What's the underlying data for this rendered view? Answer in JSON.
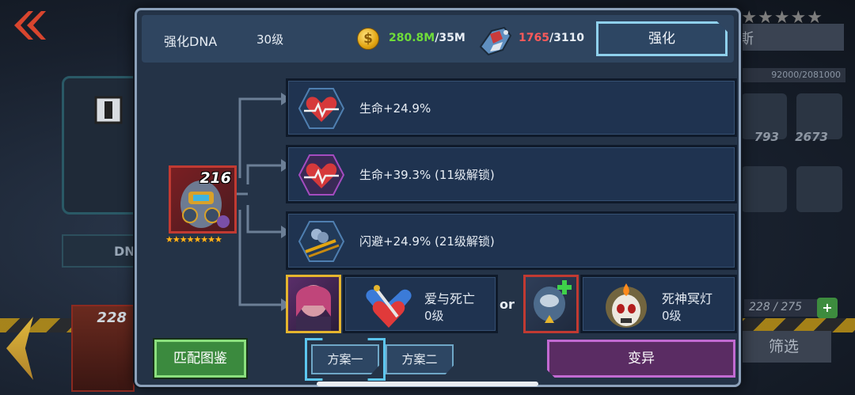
{
  "background": {
    "back_icon": "double-chevron-left-icon",
    "dna_tab": "DN",
    "card_level": "228",
    "stars": "★★★★★",
    "hero_name": "托斯",
    "exp": "92000/2081000",
    "item_counts": [
      "793",
      "2673"
    ],
    "slot_count": "228 / 275",
    "filter_label": "筛选"
  },
  "header": {
    "title": "强化DNA",
    "level": "30级",
    "coin_current": "280.8M",
    "coin_max": "/35M",
    "material_current": "1765",
    "material_max": "/3110",
    "enhance_label": "强化"
  },
  "hero": {
    "level": "216",
    "stars": "★★★★★★★★"
  },
  "bonuses": [
    {
      "icon": "heart-pulse-icon",
      "text": "生命+24.9%"
    },
    {
      "icon": "heart-pulse-icon",
      "text": "生命+39.3%  (11级解锁)"
    },
    {
      "icon": "dodge-icon",
      "text": "闪避+24.9%  (21级解锁)"
    }
  ],
  "combos": {
    "left": {
      "name": "爱与死亡",
      "level": "0级"
    },
    "or_label": "or",
    "right": {
      "name": "死神冥灯",
      "level": "0级"
    }
  },
  "footer": {
    "atlas_label": "匹配图鉴",
    "plan_one": "方案一",
    "plan_two": "方案二",
    "mutate_label": "变异"
  },
  "colors": {
    "coin_green": "#6fdc3a",
    "material_red": "#ff5a5a",
    "accent_cyan": "#8fd0ec",
    "mutate_purple": "#c26ad2",
    "atlas_green": "#3b8a3e"
  }
}
